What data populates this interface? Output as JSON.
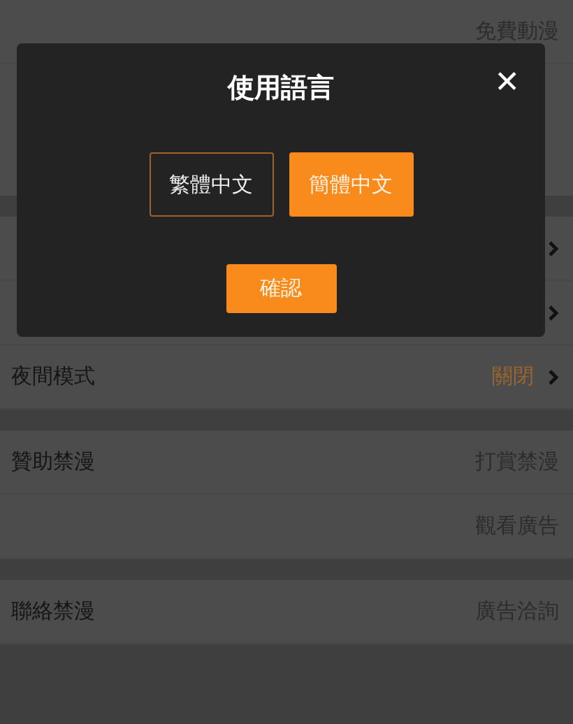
{
  "settings": [
    {
      "rows": [
        {
          "kind": "plain",
          "value": "免費動漫"
        }
      ]
    },
    {
      "rows": [
        {
          "kind": "link"
        },
        {
          "kind": "link"
        },
        {
          "kind": "link",
          "label": "夜間模式",
          "value": "關閉",
          "color": "#9a6530"
        }
      ]
    },
    {
      "rows": [
        {
          "kind": "plain",
          "label": "贊助禁漫",
          "value": "打賞禁漫"
        },
        {
          "kind": "plain",
          "value": "觀看廣告"
        }
      ]
    },
    {
      "rows": [
        {
          "kind": "plain",
          "label": "聯絡禁漫",
          "value": "廣告洽詢"
        }
      ]
    }
  ],
  "dialog": {
    "title": "使用語言",
    "close": "✕",
    "options": [
      {
        "label": "繁體中文",
        "selected": false
      },
      {
        "label": "簡體中文",
        "selected": true
      }
    ],
    "confirm": "確認"
  }
}
